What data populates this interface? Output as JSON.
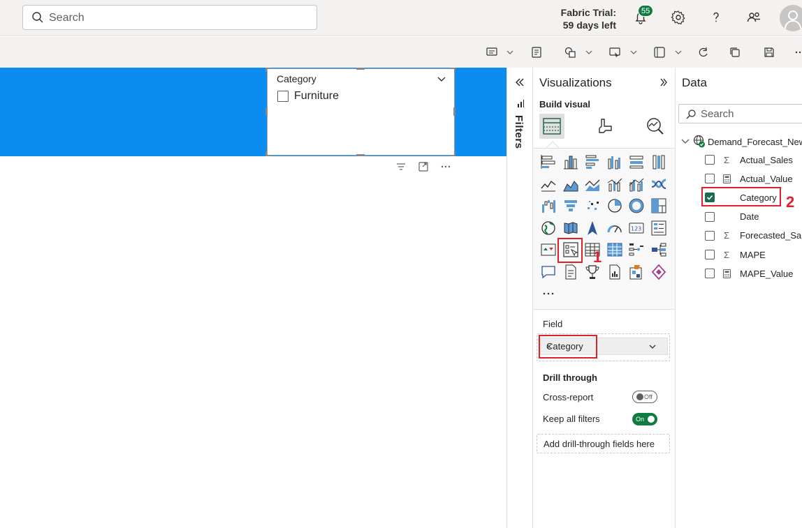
{
  "header": {
    "search_placeholder": "Search",
    "trial_line1": "Fabric Trial:",
    "trial_line2": "59 days left",
    "notifications_count": "55"
  },
  "canvas": {
    "slicer": {
      "title": "Category",
      "items": [
        "Furniture"
      ]
    }
  },
  "filters_pane": {
    "label": "Filters"
  },
  "visualizations": {
    "title": "Visualizations",
    "build_visual": "Build visual",
    "field_label": "Field",
    "field_value": "Category",
    "drill_title": "Drill through",
    "cross_report": "Cross-report",
    "cross_report_state": "Off",
    "keep_filters": "Keep all filters",
    "keep_filters_state": "On",
    "add_drill": "Add drill-through fields here",
    "more": "···"
  },
  "data_pane": {
    "title": "Data",
    "search_placeholder": "Search",
    "table_name": "Demand_Forecast_New",
    "fields": [
      {
        "name": "Actual_Sales",
        "type": "Σ",
        "checked": false
      },
      {
        "name": "Actual_Value",
        "type": "calc",
        "checked": false
      },
      {
        "name": "Category",
        "type": "",
        "checked": true
      },
      {
        "name": "Date",
        "type": "",
        "checked": false
      },
      {
        "name": "Forecasted_Sales",
        "type": "Σ",
        "checked": false
      },
      {
        "name": "MAPE",
        "type": "Σ",
        "checked": false
      },
      {
        "name": "MAPE_Value",
        "type": "calc",
        "checked": false
      }
    ]
  },
  "annotations": {
    "step1": "1",
    "step2": "2"
  },
  "colors": {
    "accent": "#107c41",
    "banner": "#0a8cf0",
    "annotation": "#e0202d"
  }
}
